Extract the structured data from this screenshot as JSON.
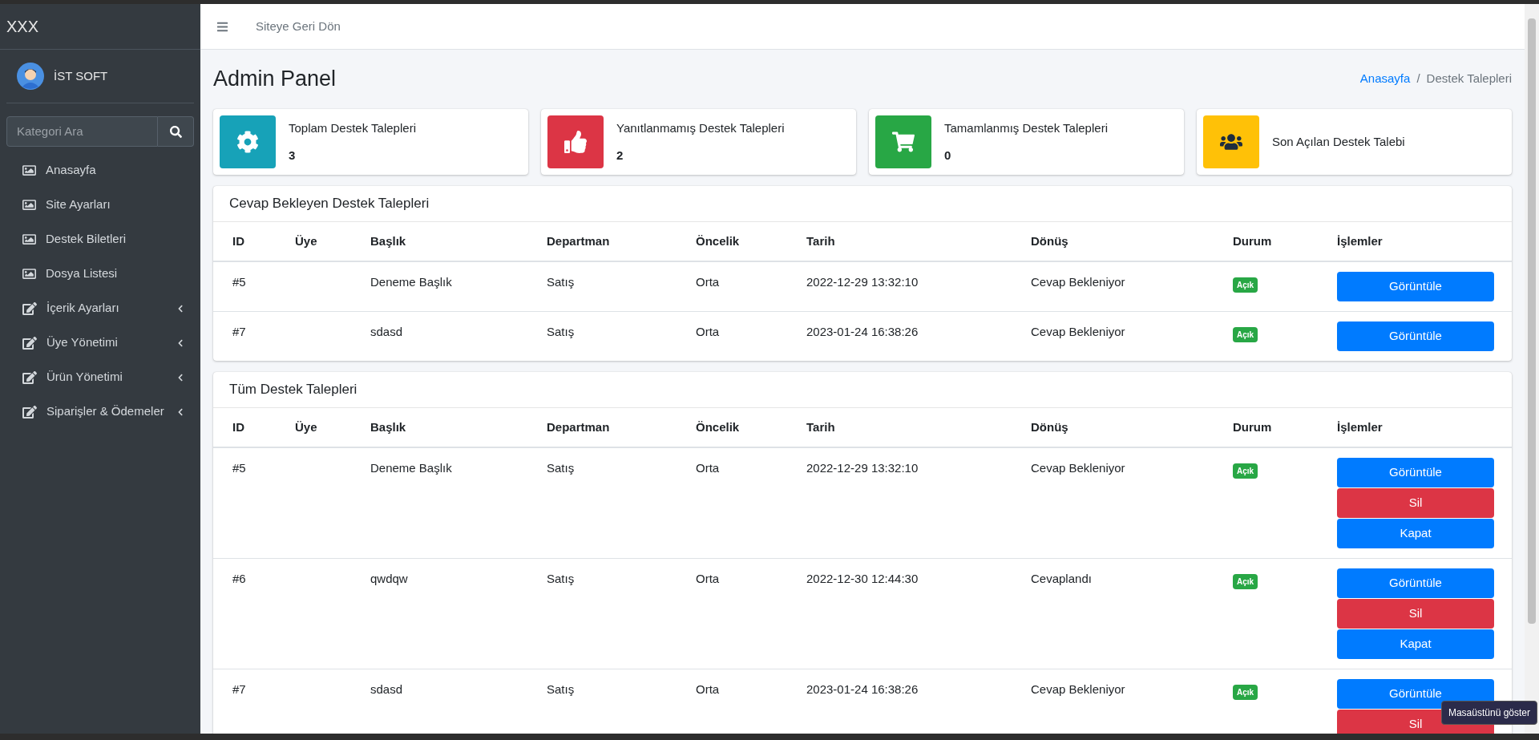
{
  "sidebar": {
    "brand": "XXX",
    "user": "İST SOFT",
    "search": {
      "placeholder": "Kategori Ara"
    },
    "items": [
      {
        "label": "Anasayfa",
        "kind": "image",
        "has_submenu": false
      },
      {
        "label": "Site Ayarları",
        "kind": "image",
        "has_submenu": false
      },
      {
        "label": "Destek Biletleri",
        "kind": "image",
        "has_submenu": false
      },
      {
        "label": "Dosya Listesi",
        "kind": "image",
        "has_submenu": false
      },
      {
        "label": "İçerik Ayarları",
        "kind": "edit",
        "has_submenu": true
      },
      {
        "label": "Üye Yönetimi",
        "kind": "edit",
        "has_submenu": true
      },
      {
        "label": "Ürün Yönetimi",
        "kind": "edit",
        "has_submenu": true
      },
      {
        "label": "Siparişler & Ödemeler",
        "kind": "edit",
        "has_submenu": true
      }
    ]
  },
  "navbar": {
    "link": "Siteye Geri Dön"
  },
  "page": {
    "title": "Admin Panel",
    "breadcrumb_separator": "/",
    "breadcrumb": [
      {
        "label": "Anasayfa",
        "link": true
      },
      {
        "label": "Destek Talepleri",
        "link": false
      }
    ]
  },
  "stats": [
    {
      "label": "Toplam Destek Talepleri",
      "value": "3",
      "kind": "gear",
      "color": "#17a2b8"
    },
    {
      "label": "Yanıtlanmamış Destek Talepleri",
      "value": "2",
      "kind": "thumb",
      "color": "#dc3545"
    },
    {
      "label": "Tamamlanmış Destek Talepleri",
      "value": "0",
      "kind": "cart",
      "color": "#28a745"
    },
    {
      "label": "Son Açılan Destek Talebi",
      "kind": "users",
      "color": "#ffc107"
    }
  ],
  "tables": [
    {
      "title": "Cevap Bekleyen Destek Talepleri",
      "columns": [
        "ID",
        "Üye",
        "Başlık",
        "Departman",
        "Öncelik",
        "Tarih",
        "Dönüş",
        "Durum",
        "İşlemler"
      ],
      "rows": [
        {
          "id": "#5",
          "title": "Deneme Başlık",
          "department": "Satış",
          "priority": "Orta",
          "date": "2022-12-29 13:32:10",
          "reply": "Cevap Bekleniyor",
          "status": "Açık",
          "actions": [
            {
              "label": "Görüntüle",
              "kind": "primary"
            }
          ]
        },
        {
          "id": "#7",
          "title": "sdasd",
          "department": "Satış",
          "priority": "Orta",
          "date": "2023-01-24 16:38:26",
          "reply": "Cevap Bekleniyor",
          "status": "Açık",
          "actions": [
            {
              "label": "Görüntüle",
              "kind": "primary"
            }
          ]
        }
      ]
    },
    {
      "title": "Tüm Destek Talepleri",
      "columns": [
        "ID",
        "Üye",
        "Başlık",
        "Departman",
        "Öncelik",
        "Tarih",
        "Dönüş",
        "Durum",
        "İşlemler"
      ],
      "rows": [
        {
          "id": "#5",
          "title": "Deneme Başlık",
          "department": "Satış",
          "priority": "Orta",
          "date": "2022-12-29 13:32:10",
          "reply": "Cevap Bekleniyor",
          "status": "Açık",
          "actions": [
            {
              "label": "Görüntüle",
              "kind": "primary"
            },
            {
              "label": "Sil",
              "kind": "danger"
            },
            {
              "label": "Kapat",
              "kind": "primary"
            }
          ]
        },
        {
          "id": "#6",
          "title": "qwdqw",
          "department": "Satış",
          "priority": "Orta",
          "date": "2022-12-30 12:44:30",
          "reply": "Cevaplandı",
          "status": "Açık",
          "actions": [
            {
              "label": "Görüntüle",
              "kind": "primary"
            },
            {
              "label": "Sil",
              "kind": "danger"
            },
            {
              "label": "Kapat",
              "kind": "primary"
            }
          ]
        },
        {
          "id": "#7",
          "title": "sdasd",
          "department": "Satış",
          "priority": "Orta",
          "date": "2023-01-24 16:38:26",
          "reply": "Cevap Bekleniyor",
          "status": "Açık",
          "actions": [
            {
              "label": "Görüntüle",
              "kind": "primary"
            },
            {
              "label": "Sil",
              "kind": "danger"
            }
          ]
        }
      ]
    }
  ],
  "tooltip": "Masaüstünü göster"
}
